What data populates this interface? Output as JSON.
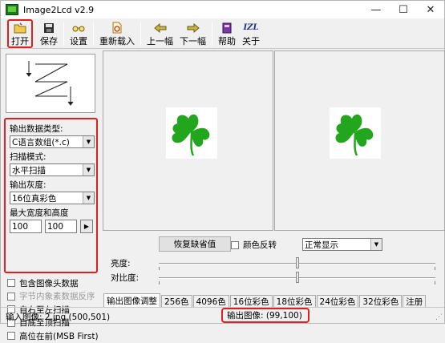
{
  "window": {
    "title": "Image2Lcd v2.9"
  },
  "window_controls": {
    "minimize": "—",
    "maximize": "☐",
    "close": "✕"
  },
  "toolbar": {
    "open": "打开",
    "save": "保存",
    "settings": "设置",
    "reload": "重新载入",
    "prev": "上一幅",
    "next": "下一幅",
    "help": "帮助",
    "about": "关于",
    "about_icon_text": "IZL"
  },
  "settings": {
    "output_type_label": "输出数据类型:",
    "output_type_value": "C语言数组(*.c)",
    "scan_mode_label": "扫描模式:",
    "scan_mode_value": "水平扫描",
    "gray_label": "输出灰度:",
    "gray_value": "16位真彩色",
    "max_size_label": "最大宽度和高度",
    "max_width": "100",
    "max_height": "100"
  },
  "checkboxes": [
    {
      "label": "包含图像头数据",
      "checked": false,
      "disabled": false
    },
    {
      "label": "字节内象素数据反序",
      "checked": false,
      "disabled": true
    },
    {
      "label": "自右至左扫描",
      "checked": false,
      "disabled": false
    },
    {
      "label": "自底至顶扫描",
      "checked": false,
      "disabled": false
    },
    {
      "label": "高位在前(MSB First)",
      "checked": false,
      "disabled": false
    }
  ],
  "controls": {
    "restore_default": "恢复缺省值",
    "invert_color": "颜色反转",
    "display_mode": "正常显示",
    "brightness_label": "亮度:",
    "brightness": 0.5,
    "contrast_label": "对比度:",
    "contrast": 0.5
  },
  "tabs": [
    "输出图像调整",
    "256色",
    "4096色",
    "16位彩色",
    "18位彩色",
    "24位彩色",
    "32位彩色",
    "注册"
  ],
  "status": {
    "input": "输入图像: 2.jpg (500,501)",
    "output": "输出图像: (99,100)"
  },
  "colors": {
    "highlight": "#e02020",
    "clover_green": "#22a61e"
  }
}
